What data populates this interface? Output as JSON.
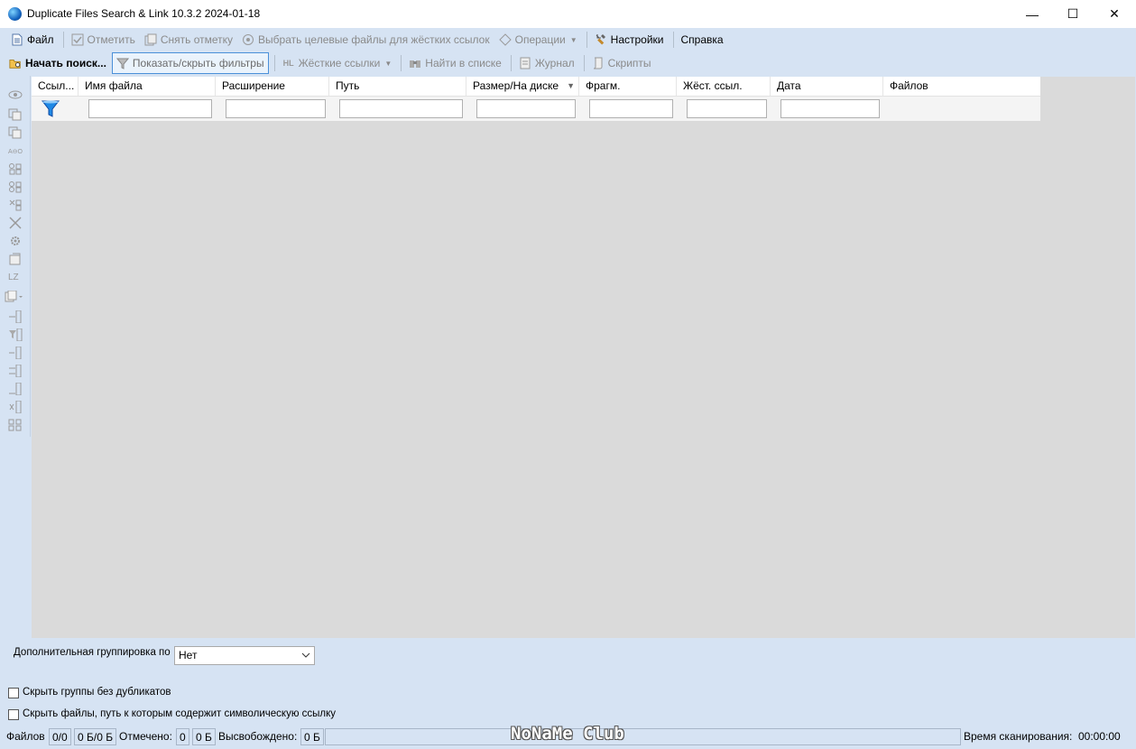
{
  "window": {
    "title": "Duplicate Files Search & Link 10.3.2 2024-01-18",
    "minimize": "—",
    "maximize": "☐",
    "close": "✕"
  },
  "menu": {
    "file": "Файл",
    "mark": "Отметить",
    "unmark": "Снять отметку",
    "select_targets": "Выбрать целевые файлы для жёстких ссылок",
    "operations": "Операции",
    "settings": "Настройки",
    "help": "Справка"
  },
  "toolbar": {
    "start_search": "Начать поиск...",
    "toggle_filters": "Показать/скрыть фильтры",
    "hardlinks": "Жёсткие ссылки",
    "find_in_list": "Найти в списке",
    "log": "Журнал",
    "scripts": "Скрипты"
  },
  "left_toolbar": {
    "lz_label": "LZ"
  },
  "grid": {
    "columns": [
      "Ссыл...",
      "Имя файла",
      "Расширение",
      "Путь",
      "Размер/На диске",
      "Фрагм.",
      "Жёст. ссыл.",
      "Дата",
      "Файлов"
    ],
    "filters": [
      "",
      "",
      "",
      "",
      "",
      "",
      ""
    ]
  },
  "options": {
    "grouping_label": "Дополнительная группировка по",
    "grouping_value": "Нет",
    "hide_groups_no_dupes": "Скрыть группы без дубликатов",
    "hide_symlink_paths": "Скрыть файлы, путь к которым содержит символическую ссылку"
  },
  "status": {
    "files_label": "Файлов",
    "files_count": "0/0",
    "files_size": "0 Б/0 Б",
    "marked_label": "Отмечено:",
    "marked_count": "0",
    "marked_size": "0 Б",
    "freed_label": "Высвобождено:",
    "freed_size": "0 Б",
    "scan_time_label": "Время сканирования:",
    "scan_time": "00:00:00"
  },
  "watermark": "NoNaMe Club",
  "colors": {
    "chrome": "#d6e3f3",
    "grid_bg": "#dadada",
    "filter_blue": "#1e88e5"
  }
}
